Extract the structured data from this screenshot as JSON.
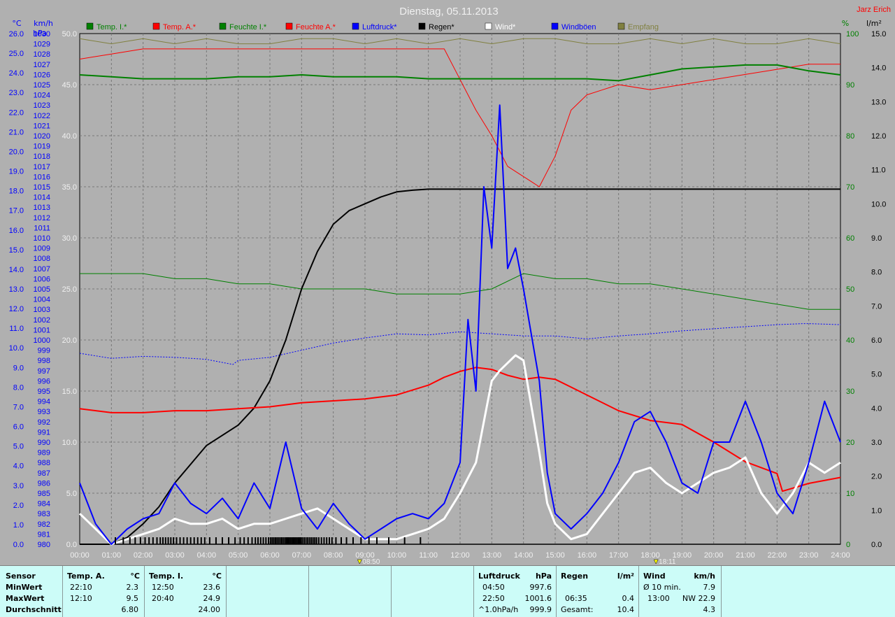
{
  "title": "Dienstag, 05.11.2013",
  "author": "Jarz Erich",
  "legend": [
    {
      "label": "Temp. I.*",
      "color": "#008000"
    },
    {
      "label": "Temp. A.*",
      "color": "#ff0000"
    },
    {
      "label": "Feuchte I.*",
      "color": "#008000"
    },
    {
      "label": "Feuchte A.*",
      "color": "#ff0000"
    },
    {
      "label": "Luftdruck*",
      "color": "#0000ff"
    },
    {
      "label": "Regen*",
      "color": "#000000"
    },
    {
      "label": "Wind*",
      "color": "#ffffff"
    },
    {
      "label": "Windböen",
      "color": "#0000ff"
    },
    {
      "label": "Empfang",
      "color": "#808040"
    }
  ],
  "axes": {
    "temp_unit": "°C",
    "pressure_unit": "hPa",
    "wind_unit": "km/h",
    "hum_unit": "%",
    "rain_unit": "l/m²",
    "temp_ticks": [
      "0.0",
      "1.0",
      "2.0",
      "3.0",
      "4.0",
      "5.0",
      "6.0",
      "7.0",
      "8.0",
      "9.0",
      "10.0",
      "11.0",
      "12.0",
      "13.0",
      "14.0",
      "15.0",
      "16.0",
      "17.0",
      "18.0",
      "19.0",
      "20.0",
      "21.0",
      "22.0",
      "23.0",
      "24.0",
      "25.0",
      "26.0"
    ],
    "pressure_ticks": [
      "980",
      "981",
      "982",
      "983",
      "984",
      "985",
      "986",
      "987",
      "988",
      "989",
      "990",
      "991",
      "992",
      "993",
      "994",
      "995",
      "996",
      "997",
      "998",
      "999",
      "1000",
      "1001",
      "1002",
      "1003",
      "1004",
      "1005",
      "1006",
      "1007",
      "1008",
      "1009",
      "1010",
      "1011",
      "1012",
      "1013",
      "1014",
      "1015",
      "1016",
      "1017",
      "1018",
      "1019",
      "1020",
      "1021",
      "1022",
      "1023",
      "1024",
      "1025",
      "1026",
      "1027",
      "1028",
      "1029",
      "1030"
    ],
    "wind_ticks": [
      "0.0",
      "5.0",
      "10.0",
      "15.0",
      "20.0",
      "25.0",
      "30.0",
      "35.0",
      "40.0",
      "45.0",
      "50.0"
    ],
    "hum_ticks": [
      "0",
      "10",
      "20",
      "30",
      "40",
      "50",
      "60",
      "70",
      "80",
      "90",
      "100"
    ],
    "rain_ticks": [
      "0.0",
      "1.0",
      "2.0",
      "3.0",
      "4.0",
      "5.0",
      "6.0",
      "7.0",
      "8.0",
      "9.0",
      "10.0",
      "11.0",
      "12.0",
      "13.0",
      "14.0",
      "15.0"
    ],
    "time_ticks": [
      "00:00",
      "01:00",
      "02:00",
      "03:00",
      "04:00",
      "05:00",
      "06:00",
      "07:00",
      "08:00",
      "09:00",
      "10:00",
      "11:00",
      "12:00",
      "13:00",
      "14:00",
      "15:00",
      "16:00",
      "17:00",
      "18:00",
      "19:00",
      "20:00",
      "21:00",
      "22:00",
      "23:00",
      "24:00"
    ],
    "markers": [
      {
        "time": "08:50",
        "hour": 8.83
      },
      {
        "time": "18:11",
        "hour": 18.18
      }
    ]
  },
  "chart_data": {
    "type": "line",
    "x_unit": "hour of day",
    "xlim": [
      0,
      24
    ],
    "series": [
      {
        "name": "Temp. I.*",
        "axis": "temp",
        "color": "#008000",
        "width": 2,
        "x": [
          0,
          1,
          2,
          3,
          4,
          5,
          6,
          7,
          8,
          9,
          10,
          11,
          12,
          13,
          14,
          15,
          16,
          17,
          18,
          19,
          20,
          21,
          22,
          23,
          24
        ],
        "y": [
          23.9,
          23.8,
          23.7,
          23.7,
          23.7,
          23.8,
          23.8,
          23.9,
          23.8,
          23.8,
          23.8,
          23.7,
          23.7,
          23.7,
          23.7,
          23.7,
          23.7,
          23.6,
          23.9,
          24.2,
          24.3,
          24.4,
          24.4,
          24.1,
          23.9
        ]
      },
      {
        "name": "Temp. A.*",
        "axis": "temp",
        "color": "#ff0000",
        "width": 2,
        "x": [
          0,
          1,
          2,
          3,
          4,
          5,
          6,
          7,
          8,
          9,
          10,
          11,
          11.5,
          12,
          12.5,
          13,
          13.5,
          14,
          14.5,
          15,
          15.5,
          16,
          17,
          18,
          19,
          20,
          21,
          22,
          22.17,
          23,
          24
        ],
        "y": [
          6.9,
          6.7,
          6.7,
          6.8,
          6.8,
          6.9,
          7.0,
          7.2,
          7.3,
          7.4,
          7.6,
          8.1,
          8.5,
          8.8,
          9.0,
          8.9,
          8.6,
          8.4,
          8.5,
          8.4,
          8.0,
          7.6,
          6.8,
          6.3,
          6.1,
          5.2,
          4.2,
          3.6,
          2.7,
          3.1,
          3.4
        ]
      },
      {
        "name": "Feuchte I.*",
        "axis": "hum",
        "color": "#008000",
        "width": 1,
        "x": [
          0,
          1,
          2,
          3,
          4,
          5,
          6,
          7,
          8,
          9,
          10,
          11,
          12,
          13,
          14,
          15,
          16,
          17,
          18,
          19,
          20,
          21,
          22,
          23,
          24
        ],
        "y": [
          53,
          53,
          53,
          52,
          52,
          51,
          51,
          50,
          50,
          50,
          49,
          49,
          49,
          50,
          53,
          52,
          52,
          51,
          51,
          50,
          49,
          48,
          47,
          46,
          46
        ]
      },
      {
        "name": "Feuchte A.*",
        "axis": "hum",
        "color": "#ff0000",
        "width": 1,
        "x": [
          0,
          1,
          2,
          3,
          4,
          5,
          6,
          7,
          8,
          9,
          10,
          11,
          11.5,
          12,
          12.5,
          13,
          13.5,
          14,
          14.5,
          15,
          15.5,
          16,
          16.5,
          17,
          18,
          19,
          20,
          21,
          22,
          23,
          24
        ],
        "y": [
          95,
          96,
          97,
          97,
          97,
          97,
          97,
          97,
          97,
          97,
          97,
          97,
          97,
          91,
          85,
          80,
          74,
          72,
          70,
          76,
          85,
          88,
          89,
          90,
          89,
          90,
          91,
          92,
          93,
          94,
          94
        ]
      },
      {
        "name": "Luftdruck*",
        "axis": "pressure",
        "color": "#0000ff",
        "width": 1,
        "dashed": true,
        "x": [
          0,
          1,
          2,
          3,
          4,
          4.83,
          5,
          6,
          7,
          8,
          9,
          10,
          11,
          12,
          13,
          14,
          15,
          16,
          17,
          18,
          19,
          20,
          21,
          22,
          22.83,
          23,
          24
        ],
        "y": [
          998.7,
          998.2,
          998.4,
          998.3,
          998.1,
          997.6,
          998.0,
          998.3,
          999.0,
          999.7,
          1000.2,
          1000.6,
          1000.5,
          1000.8,
          1000.6,
          1000.4,
          1000.4,
          1000.1,
          1000.4,
          1000.6,
          1000.9,
          1001.1,
          1001.3,
          1001.5,
          1001.6,
          1001.6,
          1001.5
        ]
      },
      {
        "name": "Regen*",
        "axis": "rain",
        "color": "#000000",
        "width": 2,
        "x": [
          0,
          1,
          1.5,
          2,
          2.5,
          3,
          4,
          5,
          5.5,
          6,
          6.5,
          7,
          7.5,
          8,
          8.5,
          9,
          9.5,
          10,
          10.5,
          11,
          12,
          24
        ],
        "y": [
          0.0,
          0.0,
          0.2,
          0.6,
          1.1,
          1.8,
          2.9,
          3.5,
          4.0,
          4.8,
          6.0,
          7.5,
          8.6,
          9.4,
          9.8,
          10.0,
          10.2,
          10.35,
          10.4,
          10.43,
          10.43,
          10.43
        ]
      },
      {
        "name": "Wind*",
        "axis": "wind",
        "color": "#ffffff",
        "width": 3,
        "x": [
          0,
          0.5,
          1,
          1.5,
          2,
          2.5,
          3,
          3.5,
          4,
          4.5,
          5,
          5.5,
          6,
          6.5,
          7,
          7.5,
          8,
          8.5,
          9,
          9.5,
          10,
          10.5,
          11,
          11.5,
          12,
          12.5,
          13,
          13.25,
          13.75,
          14,
          14.5,
          14.75,
          15,
          15.5,
          16,
          16.5,
          17,
          17.5,
          18,
          18.5,
          19,
          19.5,
          20,
          20.5,
          21,
          21.5,
          22,
          22.5,
          23,
          23.5,
          24
        ],
        "y": [
          3.0,
          1.5,
          0.0,
          0.5,
          1.0,
          1.5,
          2.5,
          2.0,
          2.0,
          2.5,
          1.5,
          2.0,
          2.0,
          2.5,
          3.0,
          3.5,
          2.5,
          1.5,
          0.5,
          0.5,
          0.5,
          1.0,
          1.5,
          2.5,
          5.0,
          8.0,
          16.0,
          17.0,
          18.5,
          18.0,
          9.0,
          4.0,
          2.0,
          0.5,
          1.0,
          3.0,
          5.0,
          7.0,
          7.5,
          6.0,
          5.0,
          6.0,
          7.0,
          7.5,
          8.5,
          5.0,
          3.0,
          5.0,
          8.0,
          7.0,
          8.0
        ]
      },
      {
        "name": "Windböen",
        "axis": "wind",
        "color": "#0000ff",
        "width": 2,
        "x": [
          0,
          0.5,
          1,
          1.5,
          2,
          2.5,
          3,
          3.5,
          4,
          4.5,
          5,
          5.5,
          6,
          6.5,
          7,
          7.5,
          8,
          8.5,
          9,
          9.5,
          10,
          10.5,
          11,
          11.5,
          12,
          12.25,
          12.5,
          12.75,
          13,
          13.25,
          13.5,
          13.75,
          14,
          14.5,
          14.75,
          15,
          15.5,
          16,
          16.5,
          17,
          17.5,
          18,
          18.5,
          19,
          19.5,
          20,
          20.5,
          21,
          21.5,
          22,
          22.5,
          23,
          23.5,
          24
        ],
        "y": [
          6.0,
          2.0,
          0.0,
          1.5,
          2.5,
          3.0,
          6.0,
          4.0,
          3.0,
          4.5,
          2.5,
          6.0,
          3.5,
          10.0,
          3.5,
          1.5,
          4.0,
          2.0,
          0.5,
          1.5,
          2.5,
          3.0,
          2.5,
          4.0,
          8.0,
          22.0,
          15.0,
          35.0,
          29.0,
          43.0,
          27.0,
          29.0,
          25.0,
          16.0,
          7.0,
          3.0,
          1.5,
          3.0,
          5.0,
          8.0,
          12.0,
          13.0,
          10.0,
          6.0,
          5.0,
          10.0,
          10.0,
          14.0,
          10.0,
          5.0,
          3.0,
          8.0,
          14.0,
          10.0
        ]
      },
      {
        "name": "Empfang",
        "axis": "hum",
        "color": "#808040",
        "width": 1,
        "x": [
          0,
          1,
          2,
          3,
          4,
          5,
          6,
          7,
          8,
          9,
          10,
          11,
          12,
          13,
          14,
          15,
          16,
          17,
          18,
          19,
          20,
          21,
          22,
          23,
          24
        ],
        "y": [
          99,
          98,
          99,
          98,
          99,
          98,
          98,
          99,
          99,
          98,
          99,
          98,
          99,
          98,
          99,
          99,
          98,
          98,
          99,
          98,
          99,
          98,
          98,
          99,
          98
        ]
      }
    ]
  },
  "stats": {
    "sensor_label": "Sensor",
    "rows": [
      "MinWert",
      "MaxWert",
      "Durchschnitt"
    ],
    "temp_a": {
      "header": "Temp. A.",
      "unit": "°C",
      "times": [
        "22:10",
        "12:10",
        ""
      ],
      "values": [
        "2.3",
        "9.5",
        "6.80"
      ]
    },
    "temp_i": {
      "header": "Temp. I.",
      "unit": "°C",
      "times": [
        "12:50",
        "20:40",
        ""
      ],
      "values": [
        "23.6",
        "24.9",
        "24.00"
      ]
    },
    "pressure": {
      "header": "Luftdruck",
      "unit": "hPa",
      "times": [
        "04:50",
        "22:50",
        "^1.0hPa/h"
      ],
      "values": [
        "997.6",
        "1001.6",
        "999.9"
      ]
    },
    "rain": {
      "header": "Regen",
      "unit": "l/m²",
      "times": [
        "",
        "06:35",
        "Gesamt:"
      ],
      "values": [
        "",
        "0.4",
        "10.4"
      ]
    },
    "wind": {
      "header": "Wind",
      "unit": "km/h",
      "times": [
        "Ø 10 min.",
        "13:00",
        ""
      ],
      "values": [
        "7.9",
        "NW 22.9",
        "4.3"
      ]
    }
  }
}
